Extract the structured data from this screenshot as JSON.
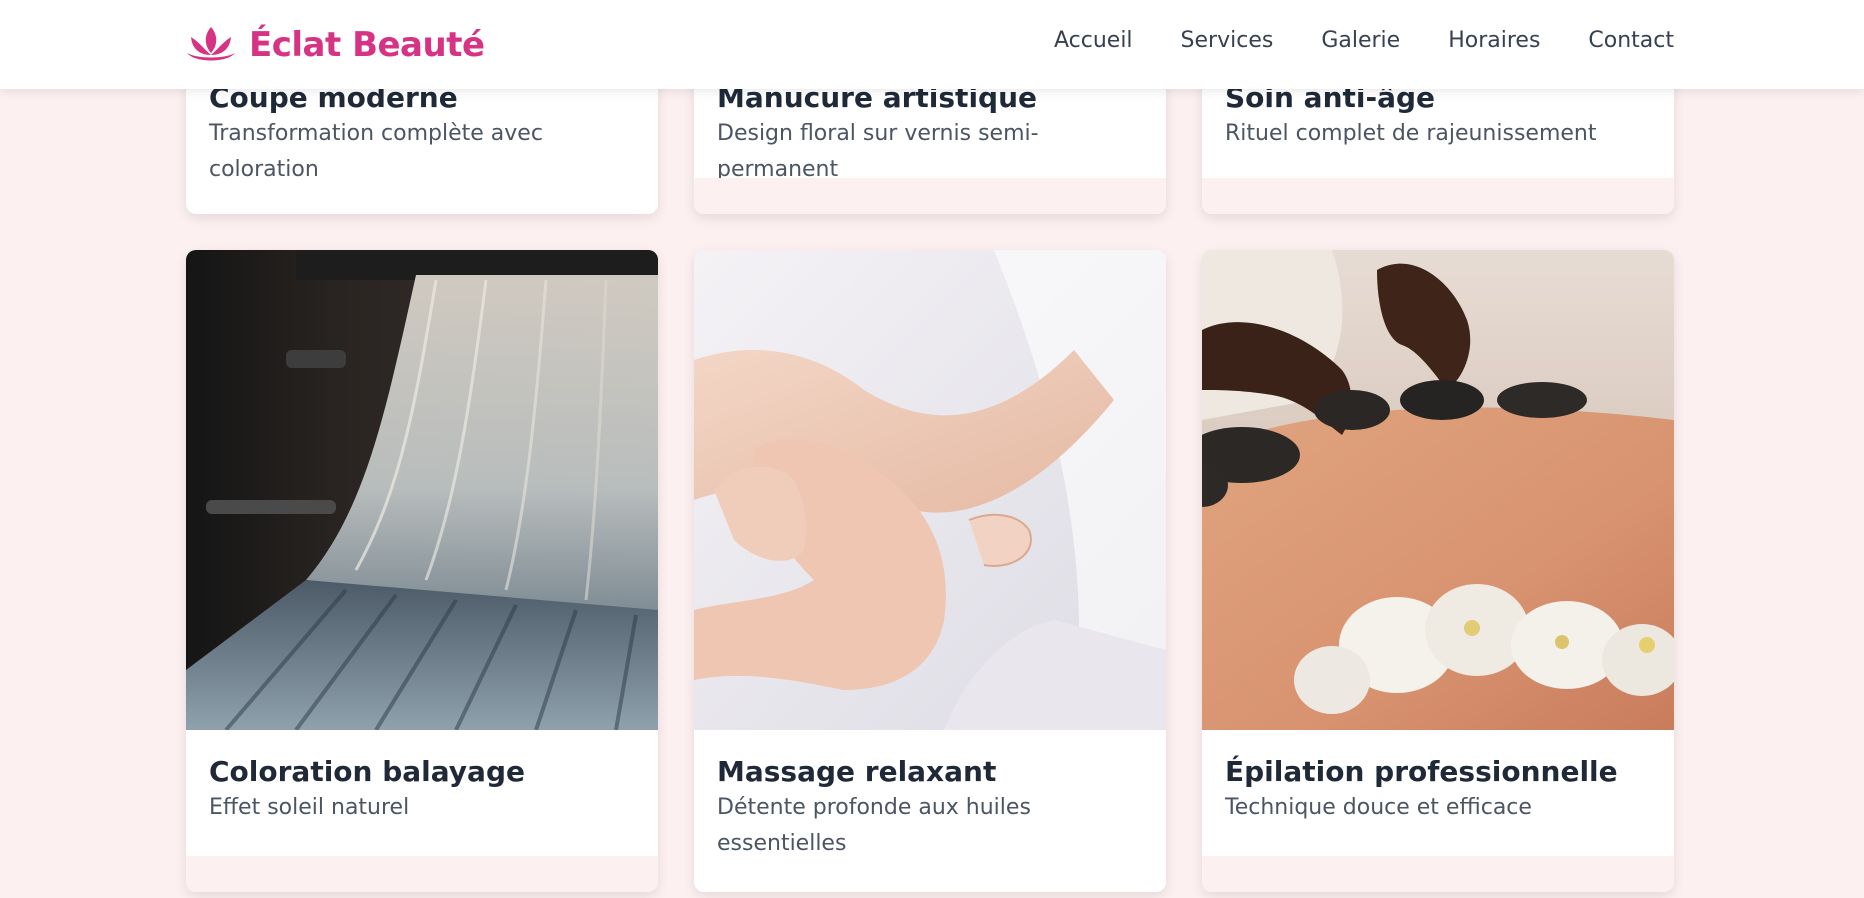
{
  "header": {
    "brand": "Éclat Beauté",
    "brand_icon": "lotus-icon",
    "brand_color": "#d63384",
    "nav": [
      "Accueil",
      "Services",
      "Galerie",
      "Horaires",
      "Contact"
    ]
  },
  "cards": [
    {
      "title": "Coupe moderne",
      "text": "Transformation complète avec coloration"
    },
    {
      "title": "Manucure artistique",
      "text": "Design floral sur vernis semi-permanent"
    },
    {
      "title": "Soin anti-âge",
      "text": "Rituel complet de rajeunissement"
    },
    {
      "title": "Coloration balayage",
      "text": "Effet soleil naturel",
      "image": "hair-strands-photo"
    },
    {
      "title": "Massage relaxant",
      "text": "Détente profonde aux huiles essentielles",
      "image": "hand-massage-photo"
    },
    {
      "title": "Épilation professionnelle",
      "text": "Technique douce et efficace",
      "image": "hot-stone-massage-photo"
    }
  ],
  "colors": {
    "page_background": "#fdf0f0",
    "card_background": "#ffffff",
    "accent": "#d63384"
  }
}
